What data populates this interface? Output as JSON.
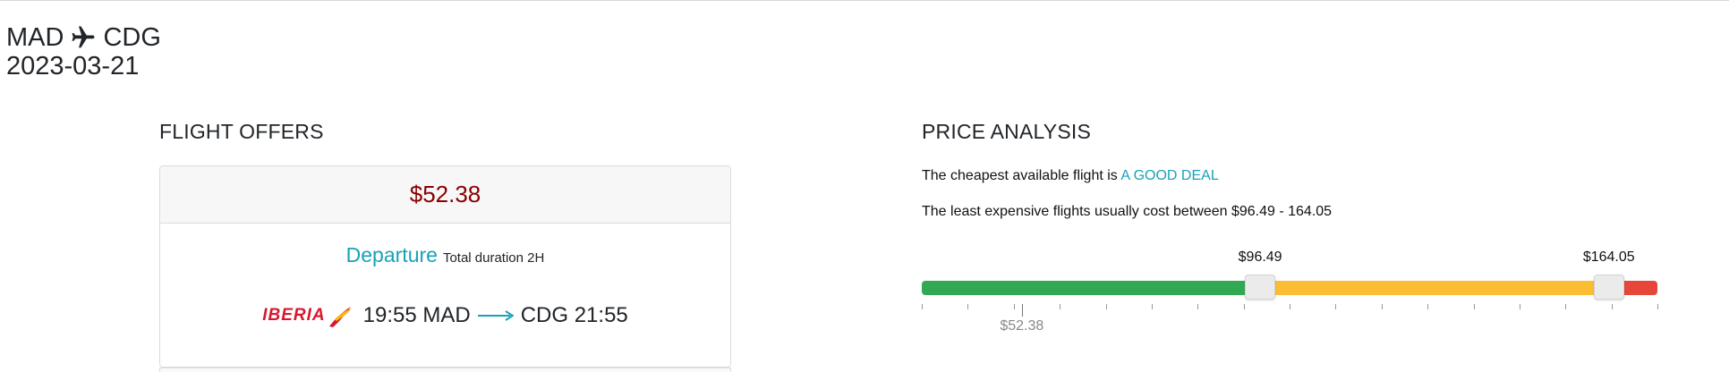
{
  "route": {
    "origin": "MAD",
    "destination": "CDG",
    "date": "2023-03-21",
    "icon": "plane-icon"
  },
  "offers": {
    "title": "FLIGHT OFFERS",
    "card": {
      "price": "$52.38",
      "departure_label": "Departure",
      "duration": "Total duration 2H",
      "airline": "IBERIA",
      "segment_from": "19:55 MAD",
      "segment_to": "CDG 21:55",
      "arrow_icon": "arrow-right-icon"
    }
  },
  "analysis": {
    "title": "PRICE ANALYSIS",
    "deal_prefix": "The cheapest available flight is",
    "deal_label": "A GOOD DEAL",
    "range_text": "The least expensive flights usually cost between $96.49 - 164.05",
    "low_label": "$96.49",
    "high_label": "$164.05",
    "marker_label": "$52.38",
    "scale": {
      "low_fraction": 0.46,
      "high_fraction": 0.934,
      "marker_fraction": 0.136,
      "tick_count": 17
    },
    "colors": {
      "good": "#33a852",
      "typical": "#fbbd34",
      "high": "#e6473a",
      "deal_accent": "#17a2b8",
      "price_accent": "#8b0000"
    }
  }
}
